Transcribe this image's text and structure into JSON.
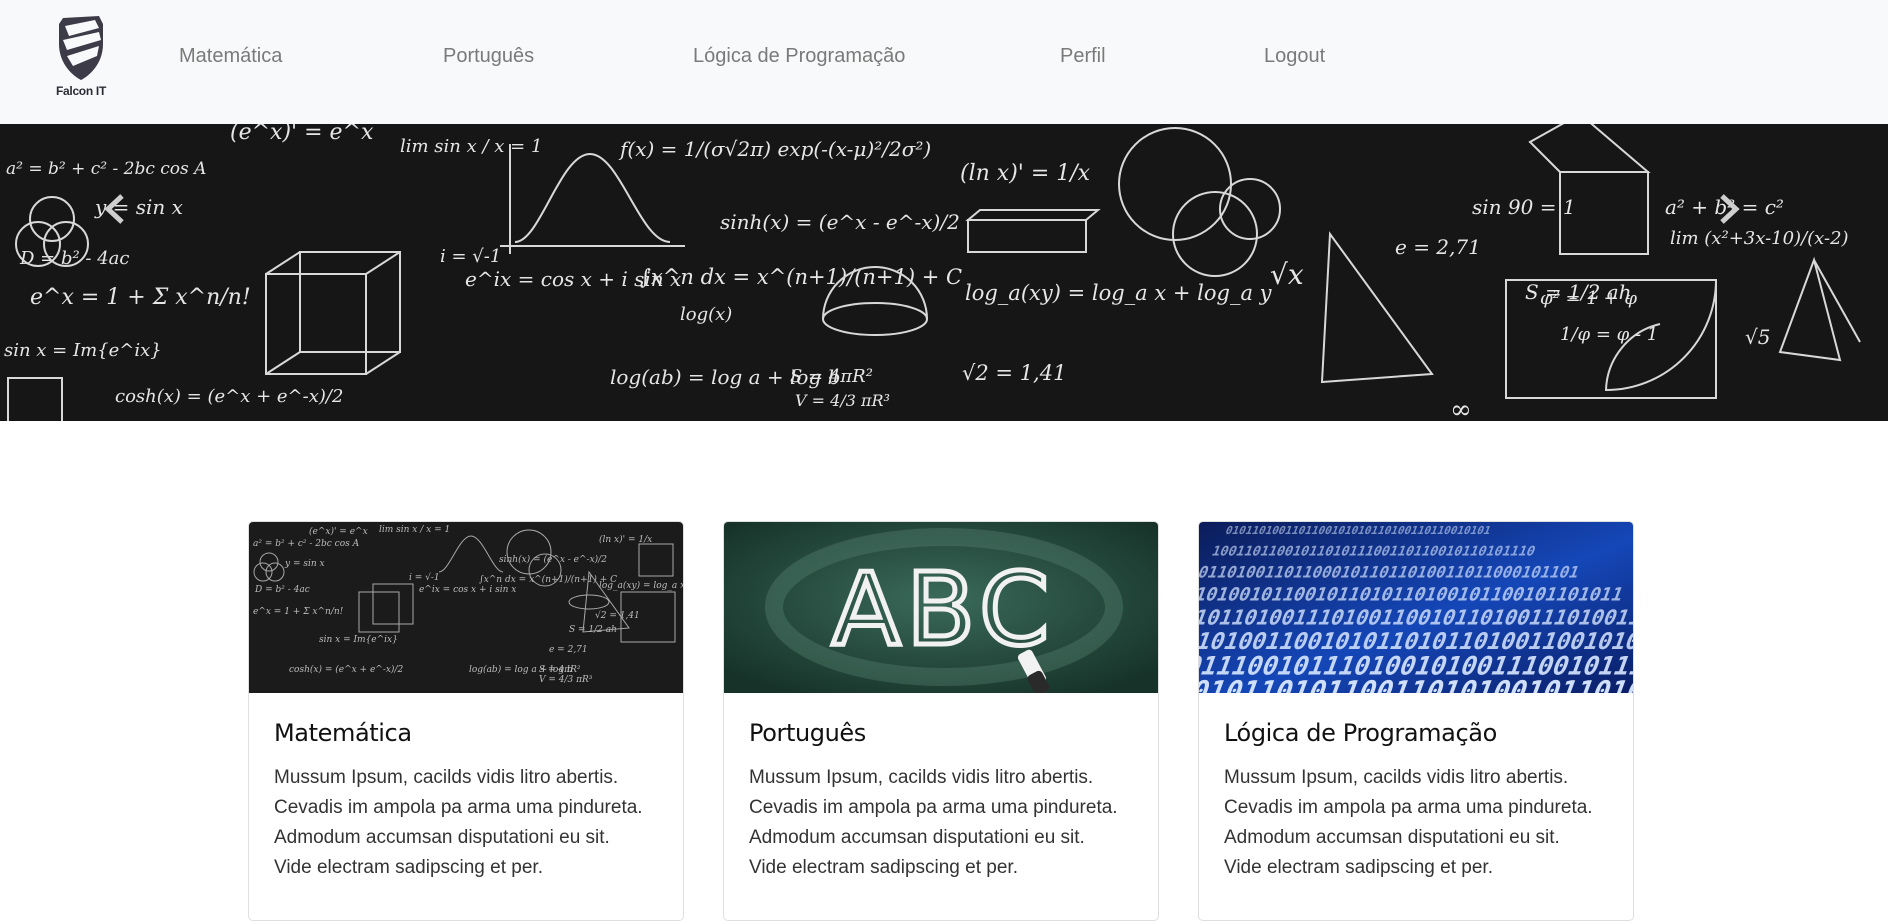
{
  "brand": {
    "name": "Falcon IT",
    "logo_icon": "falcon-shield-icon",
    "logo_color": "#3d3b47"
  },
  "nav": {
    "items": [
      {
        "label": "Matemática"
      },
      {
        "label": "Português"
      },
      {
        "label": "Lógica de Programação"
      },
      {
        "label": "Perfil"
      },
      {
        "label": "Logout"
      }
    ]
  },
  "hero": {
    "image": "chalkboard-math-formulas",
    "formulas": [
      "(e^x)' = e^x",
      "lim sin x / x = 1",
      "a² = b² + c² - 2bc cos A",
      "y = sin x",
      "D = b² - 4ac",
      "e^x = 1 + Σ x^n/n!",
      "sin x = Im{e^ix}",
      "i = √-1",
      "e^ix = cos x + i sin x",
      "∫x^n dx = x^(n+1)/(n+1) + C",
      "sinh(x) = (e^x - e^-x)/2",
      "cosh(x) = (e^x + e^-x)/2",
      "log(ab) = log a + log b",
      "S = 4πR²",
      "V = 4/3 πR³",
      "(ln x)' = 1/x",
      "log_a(xy) = log_a x + log_a y",
      "√2 = 1,41",
      "e = 2,71",
      "S = 1/2 ah",
      "sin 90 = 1",
      "φ² = 1 + φ",
      "1/φ = φ - 1",
      "a² + b² = c²",
      "lim (x²+3x-10)/(x-2)",
      "√5",
      "√x",
      "∞",
      "log(x)",
      "f(x) = 1/(σ√2π) exp(-(x-μ)²/2σ²)"
    ]
  },
  "cards": [
    {
      "title": "Matemática",
      "image": "chalkboard-math-thumbnail",
      "text": [
        "Mussum Ipsum, cacilds vidis litro abertis.",
        "Cevadis im ampola pa arma uma pindureta.",
        "Admodum accumsan disputationi eu sit.",
        "Vide electram sadipscing et per."
      ]
    },
    {
      "title": "Português",
      "image": "chalkboard-abc-thumbnail",
      "image_text": "ABC",
      "text": [
        "Mussum Ipsum, cacilds vidis litro abertis.",
        "Cevadis im ampola pa arma uma pindureta.",
        "Admodum accumsan disputationi eu sit.",
        "Vide electram sadipscing et per."
      ]
    },
    {
      "title": "Lógica de Programação",
      "image": "binary-code-thumbnail",
      "binary_rows": [
        "0101101001101100101",
        "1001101100101101011",
        "0110100110110001011",
        "1101001011001011010",
        "0010110100111010011",
        "1011010011001010110",
        "0100111001011101001",
        "1010010110101100110"
      ],
      "text": [
        "Mussum Ipsum, cacilds vidis litro abertis.",
        "Cevadis im ampola pa arma uma pindureta.",
        "Admodum accumsan disputationi eu sit.",
        "Vide electram sadipscing et per."
      ]
    }
  ],
  "colors": {
    "navbar_bg": "#f8f9fa",
    "nav_link": "#7a7a7a",
    "chalkboard": "#161616",
    "chalk": "#e8e8e8",
    "green_board": "#24473c",
    "binary_blue": "#1f5fd6"
  }
}
